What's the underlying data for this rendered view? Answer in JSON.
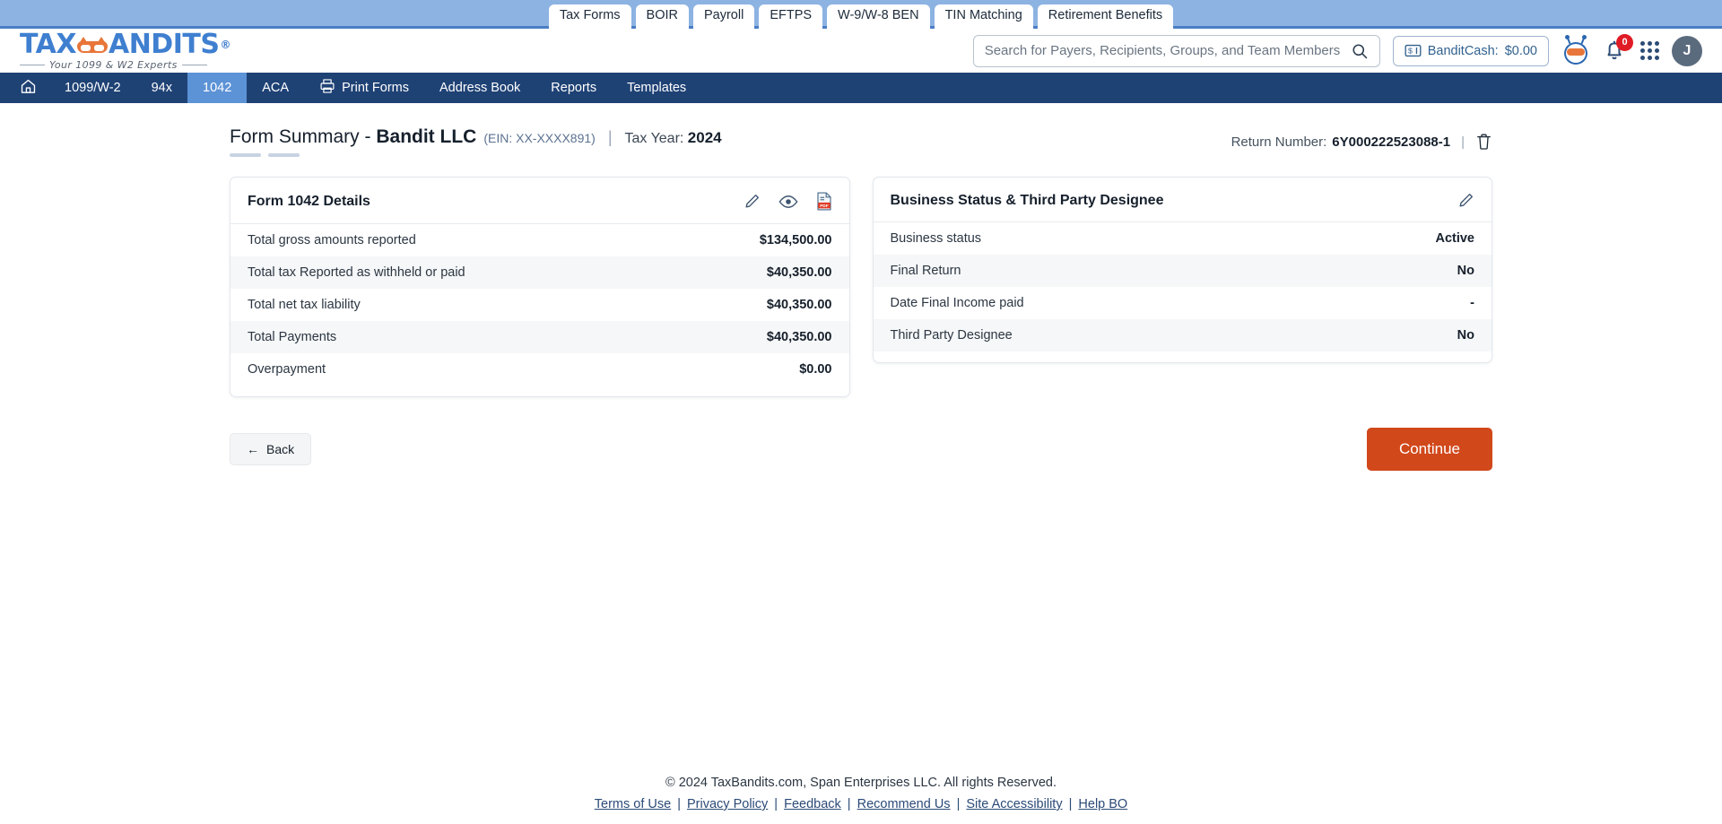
{
  "product_tabs": [
    {
      "label": "Tax Forms",
      "active": true
    },
    {
      "label": "BOIR",
      "active": false
    },
    {
      "label": "Payroll",
      "active": false
    },
    {
      "label": "EFTPS",
      "active": false
    },
    {
      "label": "W-9/W-8 BEN",
      "active": false
    },
    {
      "label": "TIN Matching",
      "active": false
    },
    {
      "label": "Retirement Benefits",
      "active": false
    }
  ],
  "header": {
    "logo_text_1": "TAX",
    "logo_text_2": "ANDITS",
    "logo_reg": "®",
    "logo_tagline": "Your 1099 & W2 Experts",
    "search_placeholder": "Search for Payers, Recipients, Groups, and Team Members",
    "search_value": "",
    "bandit_cash_label": "BanditCash:",
    "bandit_cash_amount": "$0.00",
    "notification_count": "0",
    "avatar_initial": "J"
  },
  "mainnav": [
    {
      "label": "",
      "icon": "home-icon",
      "active": false
    },
    {
      "label": "1099/W-2",
      "active": false
    },
    {
      "label": "94x",
      "active": false
    },
    {
      "label": "1042",
      "active": true
    },
    {
      "label": "ACA",
      "active": false
    },
    {
      "label": "Print Forms",
      "icon": "printer-icon",
      "active": false
    },
    {
      "label": "Address Book",
      "active": false
    },
    {
      "label": "Reports",
      "active": false
    },
    {
      "label": "Templates",
      "active": false
    }
  ],
  "page": {
    "title_prefix": "Form Summary - ",
    "company": "Bandit LLC",
    "ein": "(EIN: XX-XXXX891)",
    "separator": "|",
    "tax_year_label": "Tax Year:",
    "tax_year_value": "2024",
    "return_number_label": "Return Number:",
    "return_number_value": "6Y000222523088-1",
    "return_separator": "|"
  },
  "left_card": {
    "title": "Form 1042 Details",
    "actions": [
      "edit-icon",
      "view-icon",
      "pdf-icon"
    ],
    "rows": [
      {
        "label": "Total gross amounts reported",
        "value": "$134,500.00"
      },
      {
        "label": "Total tax Reported as withheld or paid",
        "value": "$40,350.00"
      },
      {
        "label": "Total net tax liability",
        "value": "$40,350.00"
      },
      {
        "label": "Total Payments",
        "value": "$40,350.00"
      },
      {
        "label": "Overpayment",
        "value": "$0.00"
      }
    ]
  },
  "right_card": {
    "title": "Business Status & Third Party Designee",
    "actions": [
      "edit-icon"
    ],
    "rows": [
      {
        "label": "Business status",
        "value": "Active"
      },
      {
        "label": "Final Return",
        "value": "No"
      },
      {
        "label": "Date Final Income paid",
        "value": "-"
      },
      {
        "label": "Third Party Designee",
        "value": "No"
      }
    ]
  },
  "buttons": {
    "back_label": "Back",
    "back_arrow": "←",
    "continue_label": "Continue"
  },
  "footer": {
    "copyright": "© 2024 TaxBandits.com, Span Enterprises LLC. All rights Reserved.",
    "links": [
      "Terms of Use",
      "Privacy Policy",
      "Feedback",
      "Recommend Us",
      "Site Accessibility",
      "Help BO"
    ],
    "link_separator": "|"
  },
  "colors": {
    "accent_orange": "#d1481b",
    "nav_blue": "#1f4275",
    "nav_active_blue": "#5c92d6",
    "top_strip": "#8cb3e2",
    "badge_red": "#e01b24"
  }
}
